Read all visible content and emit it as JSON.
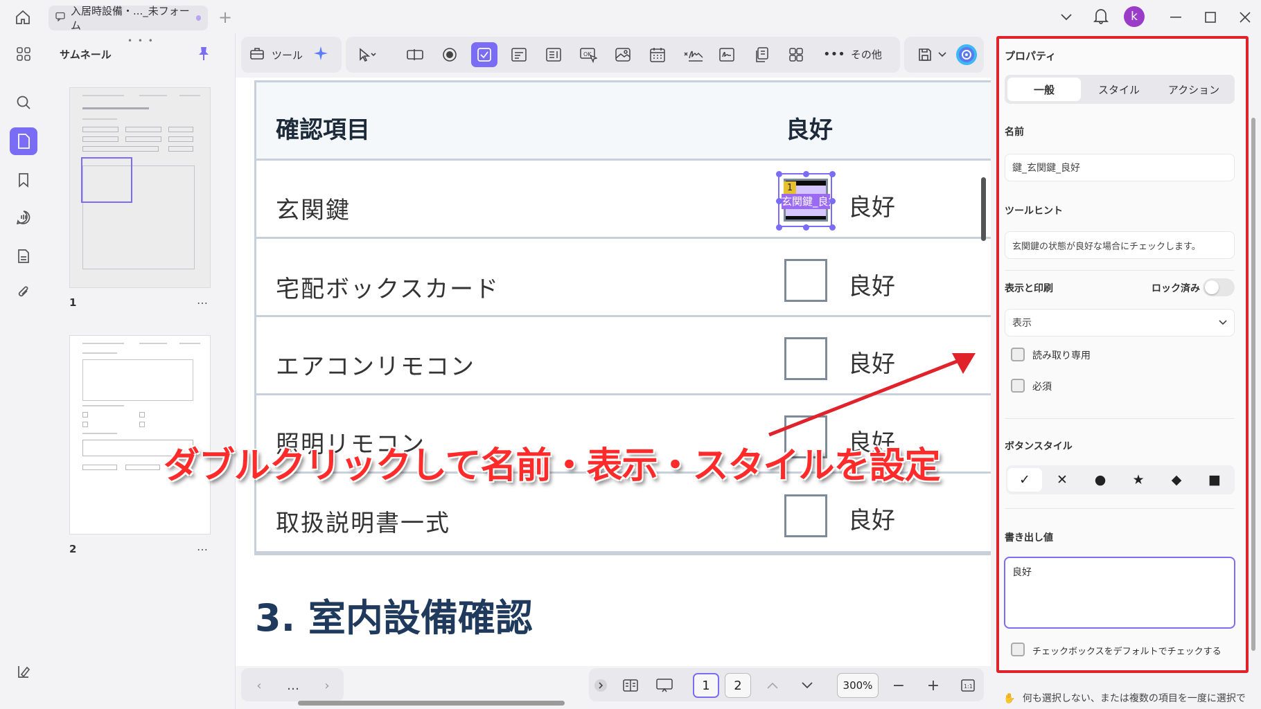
{
  "titlebar": {
    "tab_title": "入居時設備・..._未フォーム",
    "avatar_letter": "k"
  },
  "thumbnails": {
    "title": "サムネール",
    "pages": [
      {
        "number": "1",
        "more": "…"
      },
      {
        "number": "2",
        "more": "…"
      }
    ]
  },
  "toolbar": {
    "tools_label": "ツール",
    "more_label": "その他"
  },
  "document": {
    "table": {
      "headers": [
        "確認項目",
        "良好"
      ],
      "rows": [
        {
          "item": "玄関鍵",
          "status": "良好"
        },
        {
          "item": "宅配ボックスカード",
          "status": "良好"
        },
        {
          "item": "エアコンリモコン",
          "status": "良好"
        },
        {
          "item": "照明リモコン",
          "status": "良好"
        },
        {
          "item": "取扱説明書一式",
          "status": "良好"
        }
      ]
    },
    "selected_field": {
      "badge": "1",
      "label": "玄関鍵_良好"
    },
    "section_title": "3. 室内設備確認"
  },
  "annotation": {
    "caption": "ダブルクリックして名前・表示・スタイルを設定",
    "color": "#ff2a2a"
  },
  "bottombar": {
    "more": "…",
    "pages": [
      "1",
      "2"
    ],
    "current_page": "1",
    "zoom": "300%"
  },
  "properties": {
    "title": "プロパティ",
    "tabs": [
      "一般",
      "スタイル",
      "アクション"
    ],
    "active_tab": "一般",
    "name_label": "名前",
    "name_value": "鍵_玄関鍵_良好",
    "tooltip_label": "ツールヒント",
    "tooltip_value": "玄関鍵の状態が良好な場合にチェックします。",
    "visibility_label": "表示と印刷",
    "locked_label": "ロック済み",
    "visibility_value": "表示",
    "readonly_label": "読み取り専用",
    "required_label": "必須",
    "button_style_label": "ボタンスタイル",
    "button_styles": [
      "✓",
      "✕",
      "●",
      "★",
      "◆",
      "■"
    ],
    "export_label": "書き出し値",
    "export_value": "良好",
    "default_checked_label": "チェックボックスをデフォルトでチェックする",
    "footer_hint": "何も選択しない、または複数の項目を一度に選択で"
  },
  "colors": {
    "accent": "#7b6cf6",
    "highlight_border": "#e0222a"
  }
}
